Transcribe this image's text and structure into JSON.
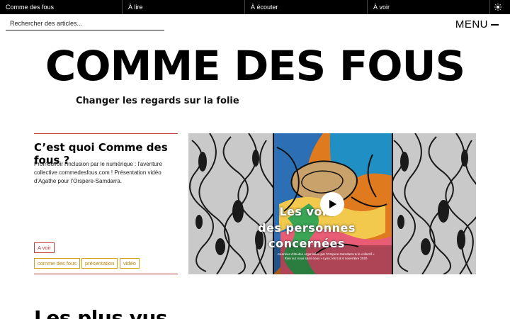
{
  "nav": {
    "items": [
      {
        "label": "Comme des fous"
      },
      {
        "label": "À lire"
      },
      {
        "label": "À écouter"
      },
      {
        "label": "À voir"
      }
    ],
    "theme_icon": "sun-icon"
  },
  "search": {
    "placeholder": "Rechercher des articles..."
  },
  "menu": {
    "label": "MENU"
  },
  "site": {
    "title": "COMME DES FOUS",
    "tagline": "Changer les regards sur la folie"
  },
  "feature": {
    "title": "C’est quoi Comme des fous ?",
    "description": "Promouvoir l'inclusion par le numérique : l'aventure collective commedesfous.com ! Présentation vidéo d'Agathe pour l'Orspere-Samdarra.",
    "category": "A voir",
    "keywords": [
      "comme des fous",
      "présentation",
      "vidéo"
    ],
    "video": {
      "title_lines": [
        "Les voix",
        "des personnes",
        "concernées"
      ],
      "caption": "Journées d'études organisées par l'Orspere-Samdarra & le collectif « Rien sur nous sans nous » Lyon, les 5 & 6 novembre 2020",
      "play_icon": "play-icon"
    }
  },
  "section": {
    "heading": "Les plus vus"
  },
  "colors": {
    "accent_red": "#c23b3b",
    "accent_gold": "#d4a017",
    "nav_bg": "#000000"
  }
}
